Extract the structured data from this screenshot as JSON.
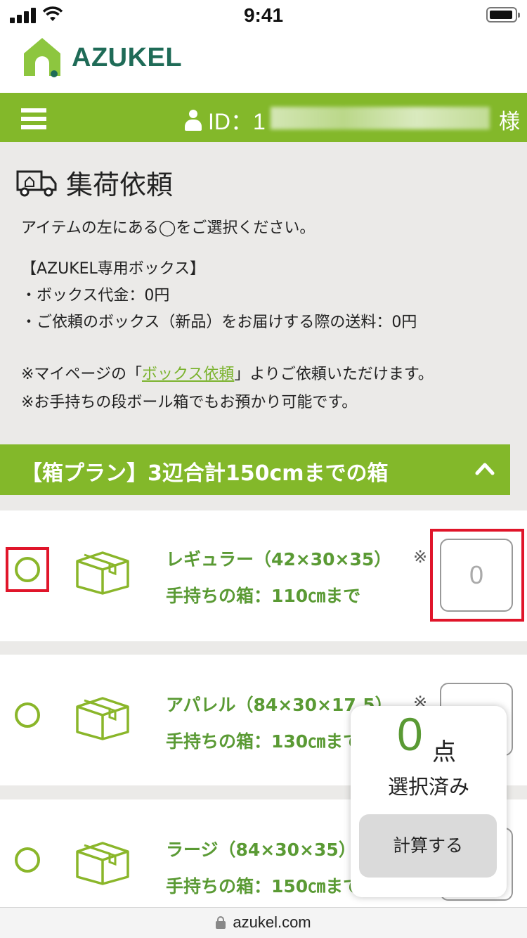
{
  "status_bar": {
    "time": "9:41"
  },
  "brand": {
    "name": "AZUKEL",
    "primary_color": "#83b82a",
    "logo_text_color": "#1f6b57"
  },
  "nav": {
    "id_label": "ID：1",
    "honorific": "様"
  },
  "page": {
    "title": "集荷依頼",
    "instruction": "アイテムの左にある◯をご選択ください。",
    "box_heading": "【AZUKEL専用ボックス】",
    "box_fee": "・ボックス代金：0円",
    "box_shipping": "・ご依頼のボックス（新品）をお届けする際の送料：0円",
    "note1_prefix": "※マイページの「",
    "note1_link": "ボックス依頼",
    "note1_suffix": "」よりご依頼いただけます。",
    "note2": "※お手持ちの段ボール箱でもお預かり可能です。"
  },
  "plan": {
    "title": "【箱プラン】3辺合計150cmまでの箱"
  },
  "items": [
    {
      "name": "レギュラー（42×30×35）",
      "sub": "手持ちの箱：110㎝まで",
      "note": "※",
      "quantity": "0"
    },
    {
      "name": "アパレル（84×30×17.5）",
      "sub": "手持ちの箱：130㎝まで",
      "note": "※",
      "quantity": ""
    },
    {
      "name": "ラージ（84×30×35）",
      "sub": "手持ちの箱：150㎝まで",
      "note": "",
      "quantity": ""
    }
  ],
  "selection": {
    "count": "0",
    "unit": "点",
    "label": "選択済み",
    "calculate_label": "計算する"
  },
  "browser": {
    "url": "azukel.com"
  }
}
